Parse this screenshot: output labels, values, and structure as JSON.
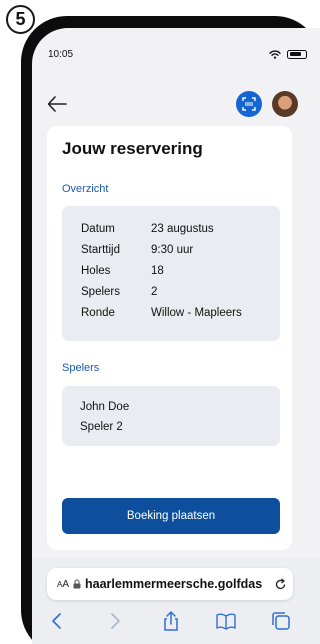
{
  "step_number": "5",
  "status_bar": {
    "time": "10:05"
  },
  "card": {
    "title": "Jouw reservering",
    "overview_heading": "Overzicht",
    "details": [
      {
        "label": "Datum",
        "value": "23 augustus"
      },
      {
        "label": "Starttijd",
        "value": "9:30 uur"
      },
      {
        "label": "Holes",
        "value": "18"
      },
      {
        "label": "Spelers",
        "value": "2"
      },
      {
        "label": "Ronde",
        "value": "Willow - Mapleers"
      }
    ],
    "players_heading": "Spelers",
    "players": [
      "John Doe",
      "Speler 2"
    ],
    "submit_label": "Boeking plaatsen"
  },
  "browser": {
    "text_size_small": "A",
    "text_size_large": "A",
    "url": "haarlemmermeersche.golfdas"
  },
  "colors": {
    "accent": "#0d4f9c",
    "heading_link": "#1c5aa6",
    "scan_button": "#1467d2",
    "panel_bg": "#e9ecf1"
  },
  "icons": [
    "back-arrow-icon",
    "scan-icon",
    "avatar",
    "wifi-icon",
    "battery-icon",
    "lock-icon",
    "reload-icon",
    "browser-back-icon",
    "browser-forward-icon",
    "share-icon",
    "bookmarks-icon",
    "tabs-icon"
  ]
}
